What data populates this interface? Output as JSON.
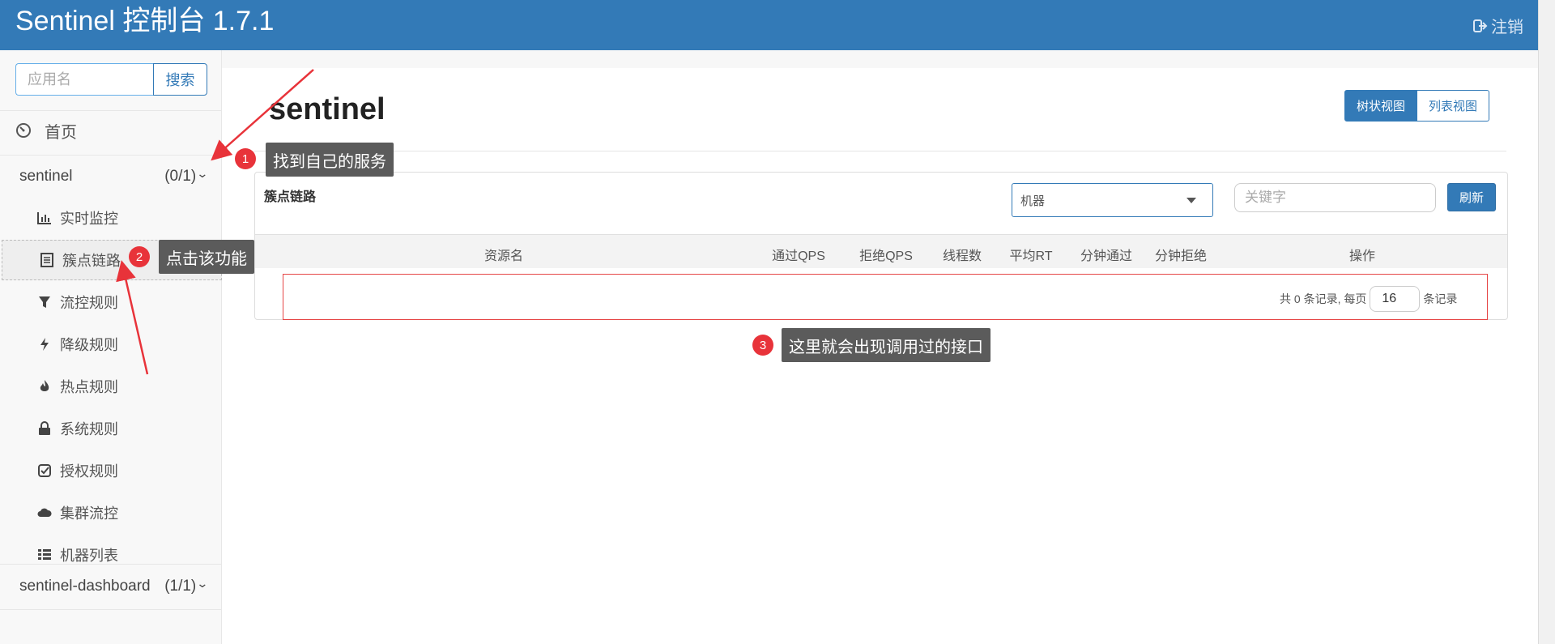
{
  "header": {
    "title": "Sentinel 控制台 1.7.1",
    "logout_label": "注销"
  },
  "sidebar": {
    "search_placeholder": "应用名",
    "search_button": "搜索",
    "home_label": "首页",
    "apps": [
      {
        "name": "sentinel",
        "count": "(0/1)"
      },
      {
        "name": "sentinel-dashboard",
        "count": "(1/1)"
      }
    ],
    "menu": [
      {
        "label": "实时监控",
        "icon": "bar-chart-icon"
      },
      {
        "label": "簇点链路",
        "icon": "list-icon",
        "active": true
      },
      {
        "label": "流控规则",
        "icon": "filter-icon"
      },
      {
        "label": "降级规则",
        "icon": "flash-icon"
      },
      {
        "label": "热点规则",
        "icon": "fire-icon"
      },
      {
        "label": "系统规则",
        "icon": "lock-icon"
      },
      {
        "label": "授权规则",
        "icon": "check-square-icon"
      },
      {
        "label": "集群流控",
        "icon": "cloud-icon"
      },
      {
        "label": "机器列表",
        "icon": "th-list-icon"
      }
    ]
  },
  "main": {
    "app_title": "sentinel",
    "view_tree": "树状视图",
    "view_list": "列表视图",
    "panel_title": "簇点链路",
    "machine_select": "机器",
    "keyword_placeholder": "关键字",
    "refresh_button": "刷新",
    "columns": [
      "资源名",
      "通过QPS",
      "拒绝QPS",
      "线程数",
      "平均RT",
      "分钟通过",
      "分钟拒绝",
      "操作"
    ],
    "pager": {
      "prefix": "共 0 条记录, 每页",
      "page_size": "16",
      "suffix": "条记录"
    }
  },
  "annotations": [
    {
      "num": "1",
      "text": "找到自己的服务"
    },
    {
      "num": "2",
      "text": "点击该功能"
    },
    {
      "num": "3",
      "text": "这里就会出现调用过的接口"
    }
  ],
  "colors": {
    "primary": "#337ab7",
    "badge": "#e8333a",
    "tooltip": "#5b5b5b",
    "highlight": "#e64646"
  }
}
